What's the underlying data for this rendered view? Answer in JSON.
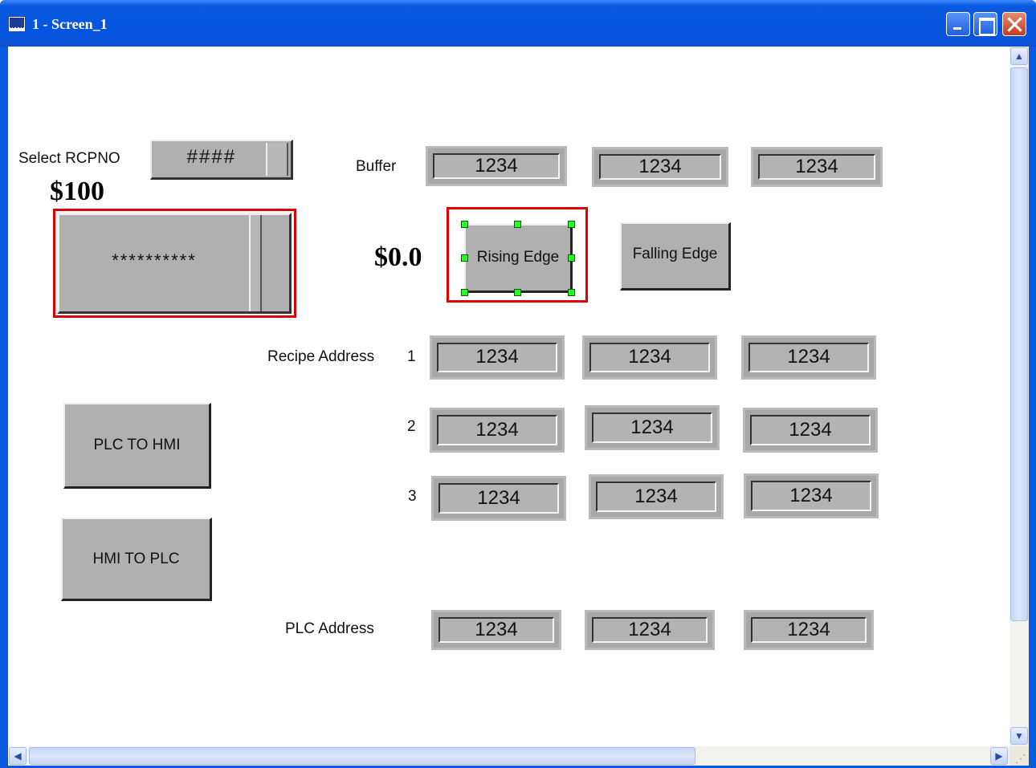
{
  "window": {
    "title": "1 - Screen_1"
  },
  "left_panel": {
    "select_label": "Select RCPNO",
    "select_value": "####",
    "address_label": "$100",
    "password_value": "**********"
  },
  "buttons": {
    "plc_to_hmi": "PLC TO HMI",
    "hmi_to_plc": "HMI TO PLC",
    "rising_edge": "Rising Edge",
    "falling_edge": "Falling Edge"
  },
  "edge_address_label": "$0.0",
  "buffer": {
    "label": "Buffer",
    "values": [
      "1234",
      "1234",
      "1234"
    ]
  },
  "recipe": {
    "label": "Recipe Address",
    "rows": [
      {
        "num": "1",
        "values": [
          "1234",
          "1234",
          "1234"
        ]
      },
      {
        "num": "2",
        "values": [
          "1234",
          "1234",
          "1234"
        ]
      },
      {
        "num": "3",
        "values": [
          "1234",
          "1234",
          "1234"
        ]
      }
    ]
  },
  "plc_address": {
    "label": "PLC Address",
    "values": [
      "1234",
      "1234",
      "1234"
    ]
  },
  "colors": {
    "selection_red": "#e00000",
    "handle_green": "#22ff22",
    "titlebar_blue": "#0a5ae0"
  }
}
